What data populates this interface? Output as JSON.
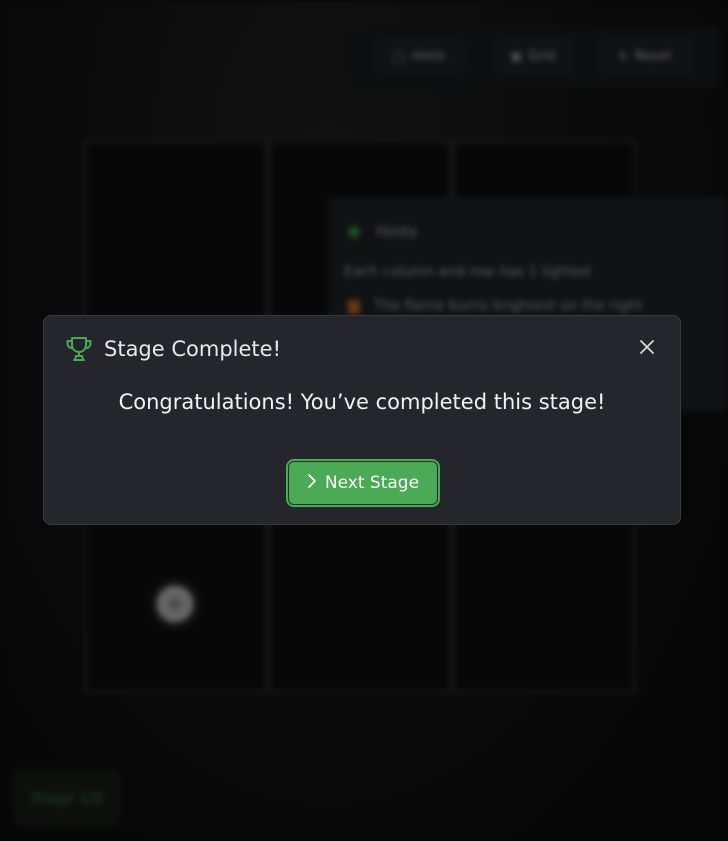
{
  "toolbar": {
    "buttons": [
      {
        "label": "Hints",
        "icon": "lightbulb-icon"
      },
      {
        "label": "Grid",
        "icon": "grid-icon"
      },
      {
        "label": "Reset",
        "icon": "reset-icon"
      }
    ]
  },
  "hint_panel": {
    "title": "Hints",
    "text": "Each column and row has 1 lighted",
    "warning": "The flame burns brightest on the right"
  },
  "stage_badge": "Stage 1/5",
  "modal": {
    "title": "Stage Complete!",
    "title_icon": "trophy-icon",
    "message": "Congratulations! You’ve completed this stage!",
    "next_button_label": "Next Stage",
    "next_button_icon": "chevron-right-icon",
    "close_icon": "close-icon",
    "accent_color": "#4aaa55"
  }
}
